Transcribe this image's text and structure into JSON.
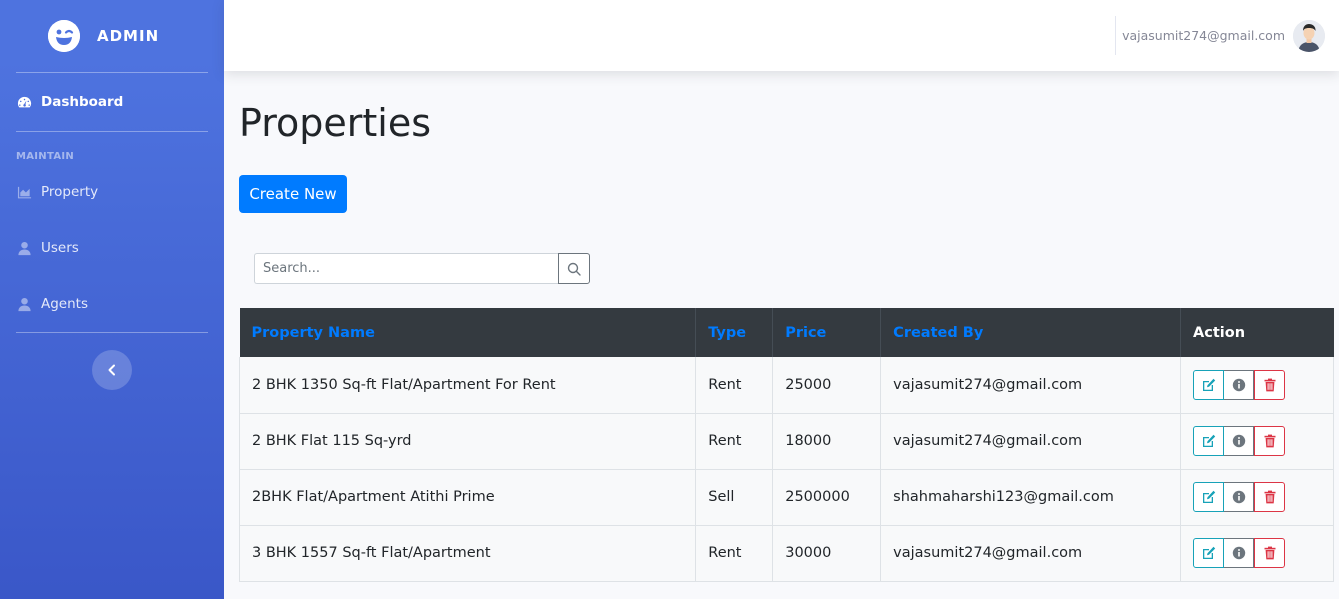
{
  "brand": {
    "name": "ADMIN",
    "icon": "laugh-wink-icon"
  },
  "sidebar": {
    "dashboard": {
      "label": "Dashboard",
      "icon": "tachometer-icon"
    },
    "section_heading": "MAINTAIN",
    "items": [
      {
        "label": "Property",
        "icon": "chart-area-icon"
      },
      {
        "label": "Users",
        "icon": "user-icon"
      },
      {
        "label": "Agents",
        "icon": "user-icon"
      }
    ],
    "toggle_icon": "chevron-left-icon"
  },
  "topbar": {
    "user_email": "vajasumit274@gmail.com"
  },
  "page": {
    "title": "Properties",
    "create_button": "Create New",
    "search": {
      "placeholder": "Search...",
      "button_icon": "search-icon"
    }
  },
  "table": {
    "headers": {
      "name": "Property Name",
      "type": "Type",
      "price": "Price",
      "created_by": "Created By",
      "action": "Action"
    },
    "rows": [
      {
        "name": "2 BHK 1350 Sq-ft Flat/Apartment For Rent",
        "type": "Rent",
        "price": "25000",
        "created_by": "vajasumit274@gmail.com"
      },
      {
        "name": "2 BHK Flat 115 Sq-yrd",
        "type": "Rent",
        "price": "18000",
        "created_by": "vajasumit274@gmail.com"
      },
      {
        "name": "2BHK Flat/Apartment Atithi Prime",
        "type": "Sell",
        "price": "2500000",
        "created_by": "shahmaharshi123@gmail.com"
      },
      {
        "name": "3 BHK 1557 Sq-ft Flat/Apartment",
        "type": "Rent",
        "price": "30000",
        "created_by": "vajasumit274@gmail.com"
      }
    ]
  },
  "colors": {
    "sidebar": "#4e73df",
    "primary": "#007bff",
    "table_head": "#343a40",
    "edit": "#17a2b8",
    "delete": "#dc3545"
  }
}
